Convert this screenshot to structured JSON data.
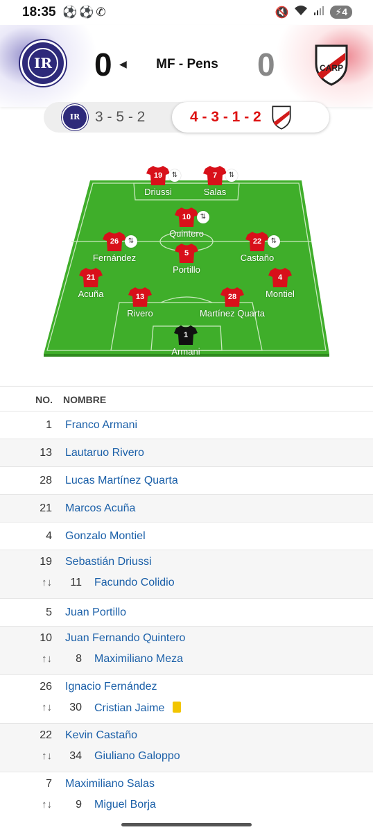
{
  "status_bar": {
    "time": "18:35",
    "left_icons": "⚽⚽✆",
    "battery": "4"
  },
  "match": {
    "home_team": "Independiente Rivadavia",
    "away_team": "River Plate",
    "home_score": "0",
    "away_score": "0",
    "status": "MF - Pens",
    "home_crest_text": "IR",
    "away_crest_text": "CARP",
    "home_color": "#2e2a7a",
    "away_color": "#d11a1a"
  },
  "formation": {
    "home": "3 - 5 - 2",
    "away": "4 - 3 - 1 - 2"
  },
  "pitch": {
    "players": [
      {
        "number": "19",
        "name": "Driussi",
        "sub": true
      },
      {
        "number": "7",
        "name": "Salas",
        "sub": true
      },
      {
        "number": "10",
        "name": "Quintero",
        "sub": true
      },
      {
        "number": "26",
        "name": "Fernández",
        "sub": true
      },
      {
        "number": "5",
        "name": "Portillo",
        "sub": false
      },
      {
        "number": "22",
        "name": "Castaño",
        "sub": true
      },
      {
        "number": "21",
        "name": "Acuña",
        "sub": false
      },
      {
        "number": "4",
        "name": "Montiel",
        "sub": false
      },
      {
        "number": "13",
        "name": "Rivero",
        "sub": false
      },
      {
        "number": "28",
        "name": "Martínez Quarta",
        "sub": false
      },
      {
        "number": "1",
        "name": "Armani",
        "sub": false,
        "goalkeeper": true
      }
    ]
  },
  "lineup_table": {
    "headers": {
      "number": "NO.",
      "name": "NOMBRE"
    },
    "sub_icon": "↑↓",
    "rows": [
      {
        "number": "1",
        "name": "Franco Armani"
      },
      {
        "number": "13",
        "name": "Lautaruo Rivero"
      },
      {
        "number": "28",
        "name": "Lucas Martínez Quarta"
      },
      {
        "number": "21",
        "name": "Marcos Acuña"
      },
      {
        "number": "4",
        "name": "Gonzalo Montiel"
      },
      {
        "number": "19",
        "name": "Sebastián Driussi",
        "sub_number": "11",
        "sub_name": "Facundo Colidio"
      },
      {
        "number": "5",
        "name": "Juan Portillo"
      },
      {
        "number": "10",
        "name": "Juan Fernando Quintero",
        "sub_number": "8",
        "sub_name": "Maximiliano Meza"
      },
      {
        "number": "26",
        "name": "Ignacio Fernández",
        "sub_number": "30",
        "sub_name": "Cristian Jaime",
        "sub_card": "yellow"
      },
      {
        "number": "22",
        "name": "Kevin Castaño",
        "sub_number": "34",
        "sub_name": "Giuliano Galoppo"
      },
      {
        "number": "7",
        "name": "Maximiliano Salas",
        "sub_number": "9",
        "sub_name": "Miguel Borja"
      }
    ]
  }
}
